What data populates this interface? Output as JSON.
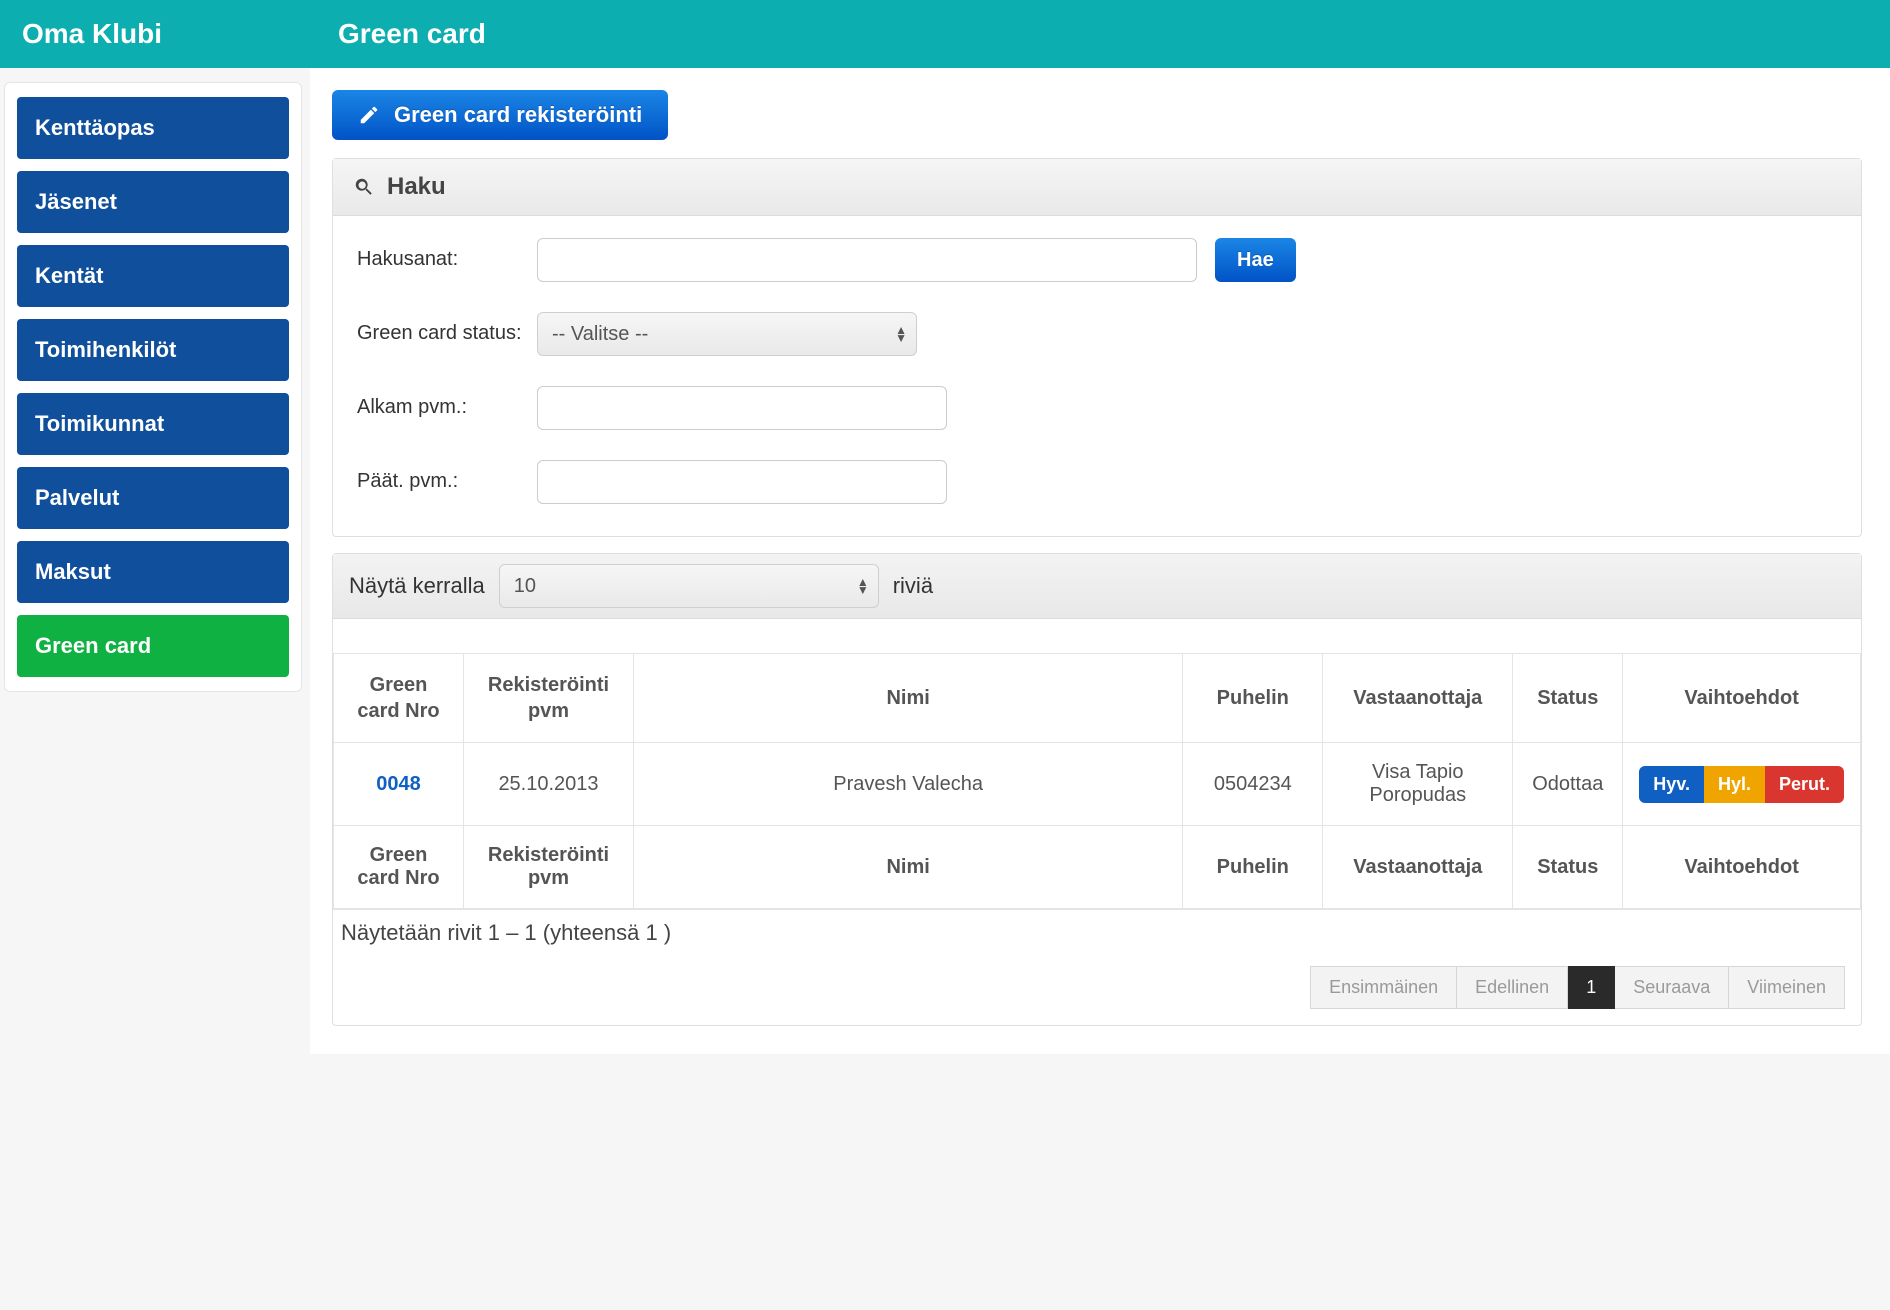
{
  "sidebar": {
    "title": "Oma Klubi",
    "items": [
      {
        "label": "Kenttäopas",
        "active": false
      },
      {
        "label": "Jäsenet",
        "active": false
      },
      {
        "label": "Kentät",
        "active": false
      },
      {
        "label": "Toimihenkilöt",
        "active": false
      },
      {
        "label": "Toimikunnat",
        "active": false
      },
      {
        "label": "Palvelut",
        "active": false
      },
      {
        "label": "Maksut",
        "active": false
      },
      {
        "label": "Green card",
        "active": true
      }
    ]
  },
  "page": {
    "title": "Green card",
    "register_btn": "Green card rekisteröinti"
  },
  "search": {
    "panel_title": "Haku",
    "label_keywords": "Hakusanat:",
    "label_status": "Green card status:",
    "label_start": "Alkam pvm.:",
    "label_end": "Päät. pvm.:",
    "status_selected": "-- Valitse --",
    "keywords_value": "",
    "start_value": "",
    "end_value": "",
    "submit": "Hae"
  },
  "list": {
    "show_prefix": "Näytä kerralla",
    "show_suffix": "riviä",
    "page_size": "10",
    "columns": {
      "nro": "Green card Nro",
      "reg": "Rekisteröinti pvm",
      "name": "Nimi",
      "phone": "Puhelin",
      "receiver": "Vastaanottaja",
      "status": "Status",
      "options": "Vaihtoehdot"
    },
    "rows": [
      {
        "nro": "0048",
        "reg": "25.10.2013",
        "name": "Pravesh Valecha",
        "phone": "0504234",
        "receiver": "Visa Tapio Poropudas",
        "status": "Odottaa",
        "actions": {
          "approve": "Hyv.",
          "reject": "Hyl.",
          "cancel": "Perut."
        }
      }
    ],
    "info": "Näytetään rivit 1 – 1 (yhteensä 1 )",
    "pager": {
      "first": "Ensimmäinen",
      "prev": "Edellinen",
      "current": "1",
      "next": "Seuraava",
      "last": "Viimeinen"
    }
  }
}
